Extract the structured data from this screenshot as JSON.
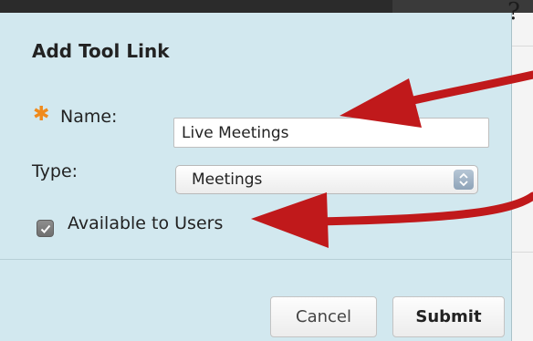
{
  "dialog": {
    "title": "Add Tool Link",
    "name_label": "Name:",
    "name_value": "Live Meetings",
    "type_label": "Type:",
    "type_selected": "Meetings",
    "available_label": "Available to Users",
    "available_checked": true,
    "cancel_label": "Cancel",
    "submit_label": "Submit"
  },
  "colors": {
    "dialog_bg": "#d2e8ef",
    "required_star": "#f08a1c",
    "annotation_arrow": "#c0191b"
  },
  "icons": [
    "required-star-icon",
    "select-arrows-icon",
    "checkmark-icon",
    "annotation-arrow-icon"
  ]
}
